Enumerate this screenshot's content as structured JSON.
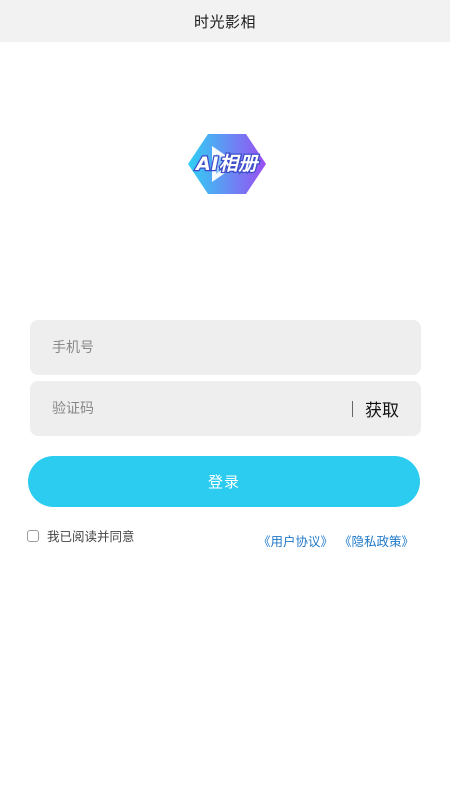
{
  "app": {
    "title": "时光影相"
  },
  "logo": {
    "text": "AI相册",
    "colors": {
      "gradient_left": "#2fd0f5",
      "gradient_right": "#9a4ef2",
      "outline": "#3b4cc9"
    }
  },
  "form": {
    "phone_placeholder": "手机号",
    "code_placeholder": "验证码",
    "get_code_label": "获取"
  },
  "login": {
    "label": "登录",
    "color": "#2ccbf0"
  },
  "agreement": {
    "text": "我已阅读并同意",
    "user_agreement": "《用户协议》",
    "privacy_policy": "《隐私政策》",
    "link_color": "#1f78c8"
  }
}
